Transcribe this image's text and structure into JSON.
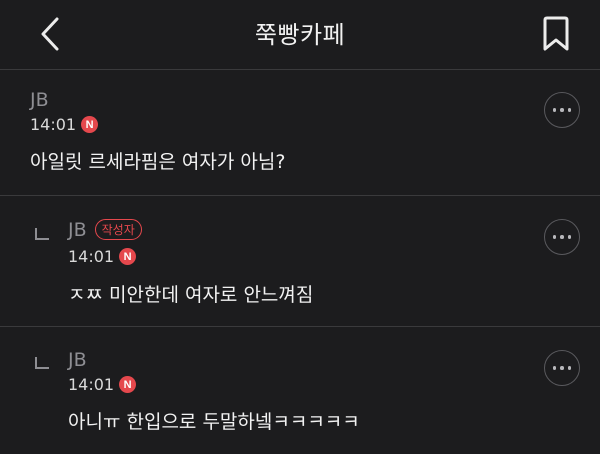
{
  "header": {
    "title": "쭉빵카페"
  },
  "comments": [
    {
      "author": "JB",
      "time": "14:01",
      "badge": "N",
      "text": "아일릿 르세라핌은 여자가 아님?"
    },
    {
      "author": "JB",
      "author_tag": "작성자",
      "time": "14:01",
      "badge": "N",
      "text": "ㅈㅉ 미안한데 여자로 안느껴짐"
    },
    {
      "author": "JB",
      "time": "14:01",
      "badge": "N",
      "text": "아니ㅠ 한입으로 두말하넼ㅋㅋㅋㅋㅋ"
    }
  ],
  "colors": {
    "background": "#1c1c1e",
    "accent": "#e5484d",
    "divider": "#3a3a3c"
  }
}
